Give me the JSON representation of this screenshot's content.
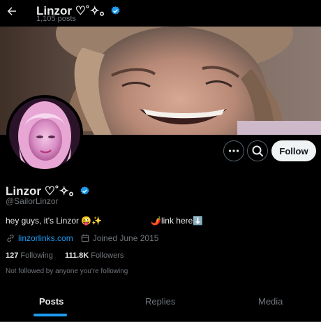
{
  "header": {
    "name": "Linzor ♡˚✧｡",
    "posts_count": "1,105 posts"
  },
  "profile": {
    "name": "Linzor ♡˚✧｡",
    "handle": "@SailorLinzor",
    "bio_text": "hey guys, it's Linzor 😜✨",
    "bio_link_text": "🌶️link here⬇️",
    "website": "linzorlinks.com",
    "joined": "Joined June 2015",
    "following_count": "127",
    "following_label": "Following",
    "followers_count": "111.8K",
    "followers_label": "Followers",
    "not_followed_text": "Not followed by anyone you're following"
  },
  "actions": {
    "follow_label": "Follow"
  },
  "tabs": [
    {
      "label": "Posts",
      "active": true
    },
    {
      "label": "Replies",
      "active": false
    },
    {
      "label": "Media",
      "active": false
    }
  ],
  "icons": {
    "verified": "verified-badge-icon",
    "back": "back-arrow-icon",
    "more": "more-icon",
    "search": "search-icon",
    "link": "link-icon",
    "calendar": "calendar-icon"
  },
  "colors": {
    "background": "#000000",
    "accent": "#1d9bf0",
    "text_primary": "#e7e9ea",
    "text_secondary": "#71767b"
  }
}
